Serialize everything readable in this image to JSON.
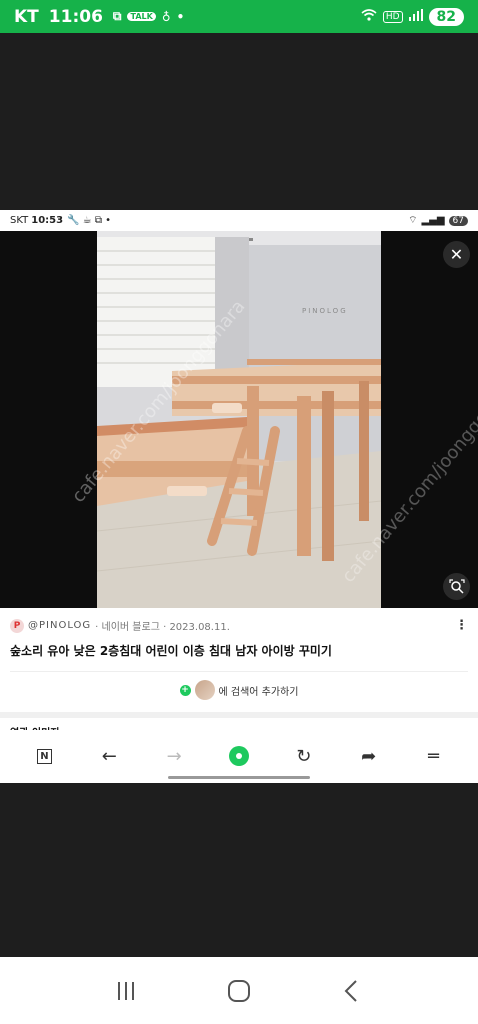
{
  "status_bar": {
    "carrier": "KT",
    "time": "11:06",
    "notif_talk": "TALK",
    "battery": "82"
  },
  "inner_status": {
    "carrier": "SKT",
    "time": "10:53",
    "battery": "67"
  },
  "viewer": {
    "watermark_brand": "PINOLOG",
    "watermark_site": "cafe.naver.com/joonggonara"
  },
  "result": {
    "source_logo": "P",
    "source_name": "@PINOLOG",
    "meta": "· 네이버 블로그 · 2023.08.11.",
    "title": "숲소리 유아 낮은 2층침대 어린이 이층 침대 남자 아이방 꾸미기",
    "add_search": "에 검색어 추가하기",
    "related_label": "연관 이미지"
  },
  "toolbar": {
    "naver_label": "N"
  },
  "colors": {
    "status_green": "#16b24a",
    "accent_green": "#1ec95e"
  }
}
